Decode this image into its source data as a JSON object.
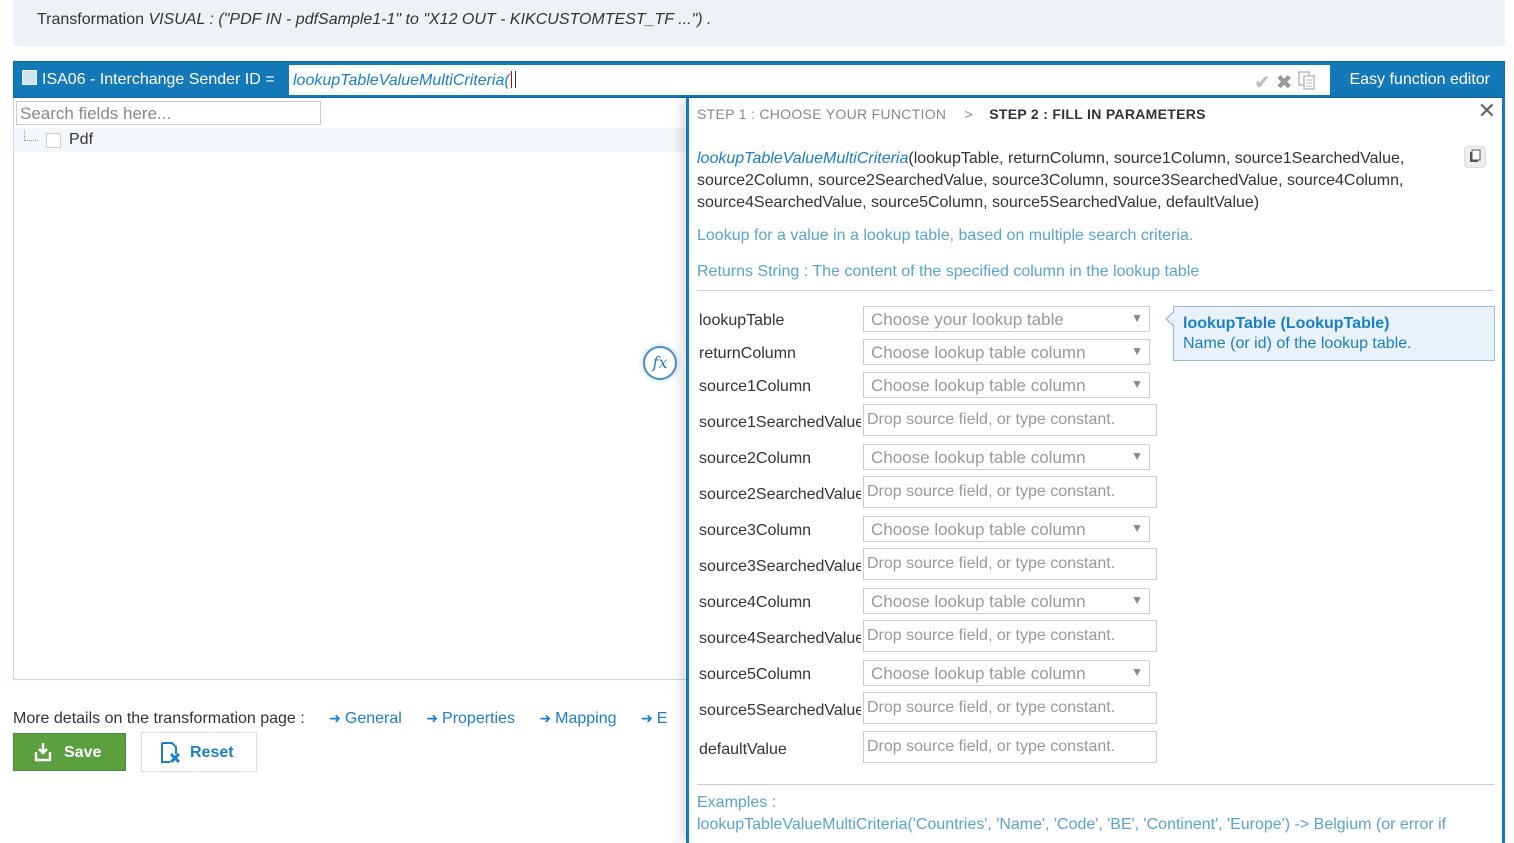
{
  "banner": {
    "prefix": "Transformation",
    "detail": "VISUAL : (\"PDF IN - pdfSample1-1\" to \"X12 OUT - KIKCUSTOMTEST_TF ...\") ."
  },
  "expression_bar": {
    "field_label": "ISA06 - Interchange Sender ID =",
    "expression_value": "lookupTableValueMultiCriteria(",
    "easy_function_editor": "Easy function editor",
    "colors": {
      "bar": "#1479b8",
      "expression_text": "#1a7fc8"
    }
  },
  "left_panel": {
    "search_placeholder": "Search fields here...",
    "tree": [
      {
        "label": "Pdf"
      }
    ]
  },
  "footer": {
    "more_details": "More details on the transformation page :",
    "links": [
      "General",
      "Properties",
      "Mapping",
      "E"
    ],
    "save_label": "Save",
    "reset_label": "Reset",
    "colors": {
      "save": "#5aa03e",
      "link": "#1a7fc8"
    }
  },
  "editor": {
    "step1": "STEP 1 : CHOOSE YOUR FUNCTION",
    "separator": ">",
    "step2": "STEP 2 : FILL IN PARAMETERS",
    "function_name": "lookupTableValueMultiCriteria",
    "function_args": "(lookupTable, returnColumn, source1Column, source1SearchedValue, source2Column, source2SearchedValue, source3Column, source3SearchedValue, source4Column, source4SearchedValue, source5Column, source5SearchedValue, defaultValue)",
    "description": "Lookup for a value in a lookup table, based on multiple search criteria.",
    "returns": "Returns String : The content of the specified column in the lookup table",
    "params": [
      {
        "label": "lookupTable",
        "kind": "select",
        "value": "Choose your lookup table"
      },
      {
        "label": "returnColumn",
        "kind": "select",
        "value": "Choose lookup table column"
      },
      {
        "label": "source1Column",
        "kind": "select",
        "value": "Choose lookup table column"
      },
      {
        "label": "source1SearchedValue",
        "kind": "input",
        "value": "Drop source field, or type constant."
      },
      {
        "label": "source2Column",
        "kind": "select",
        "value": "Choose lookup table column"
      },
      {
        "label": "source2SearchedValue",
        "kind": "input",
        "value": "Drop source field, or type constant."
      },
      {
        "label": "source3Column",
        "kind": "select",
        "value": "Choose lookup table column"
      },
      {
        "label": "source3SearchedValue",
        "kind": "input",
        "value": "Drop source field, or type constant."
      },
      {
        "label": "source4Column",
        "kind": "select",
        "value": "Choose lookup table column"
      },
      {
        "label": "source4SearchedValue",
        "kind": "input",
        "value": "Drop source field, or type constant."
      },
      {
        "label": "source5Column",
        "kind": "select",
        "value": "Choose lookup table column"
      },
      {
        "label": "source5SearchedValue",
        "kind": "input",
        "value": "Drop source field, or type constant."
      },
      {
        "label": "defaultValue",
        "kind": "input",
        "value": "Drop source field, or type constant."
      }
    ],
    "tooltip": {
      "title": "lookupTable (LookupTable)",
      "description": "Name (or id) of the lookup table."
    },
    "examples_label": "Examples :",
    "example_1": "lookupTableValueMultiCriteria('Countries', 'Name', 'Code', 'BE', 'Continent', 'Europe') -> Belgium (or error if"
  }
}
